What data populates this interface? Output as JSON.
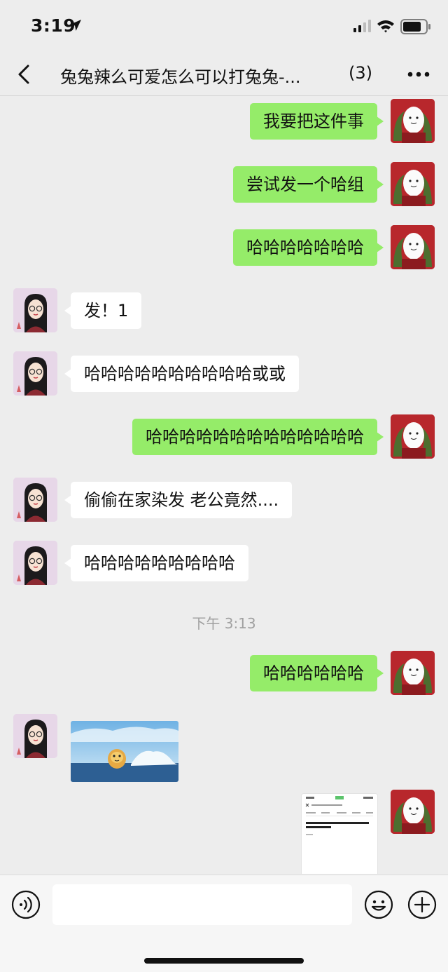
{
  "status_bar": {
    "time": "3:19"
  },
  "header": {
    "title": "兔兔辣么可爱怎么可以打兔兔-...",
    "member_count": "(3)"
  },
  "messages": [
    {
      "text": "我要把这件事"
    },
    {
      "text": "尝试发一个哈组"
    },
    {
      "text": "哈哈哈哈哈哈哈"
    },
    {
      "text": "发！1"
    },
    {
      "text": "哈哈哈哈哈哈哈哈哈哈或或"
    },
    {
      "text": "哈哈哈哈哈哈哈哈哈哈哈哈哈"
    },
    {
      "text": "偷偷在家染发 老公竟然...."
    },
    {
      "text": "哈哈哈哈哈哈哈哈哈"
    },
    {
      "text": "哈哈哈哈哈哈"
    }
  ],
  "timestamp": "下午 3:13",
  "colors": {
    "outgoing_bubble": "#95ec69",
    "incoming_bubble": "#ffffff",
    "background": "#ededed"
  }
}
